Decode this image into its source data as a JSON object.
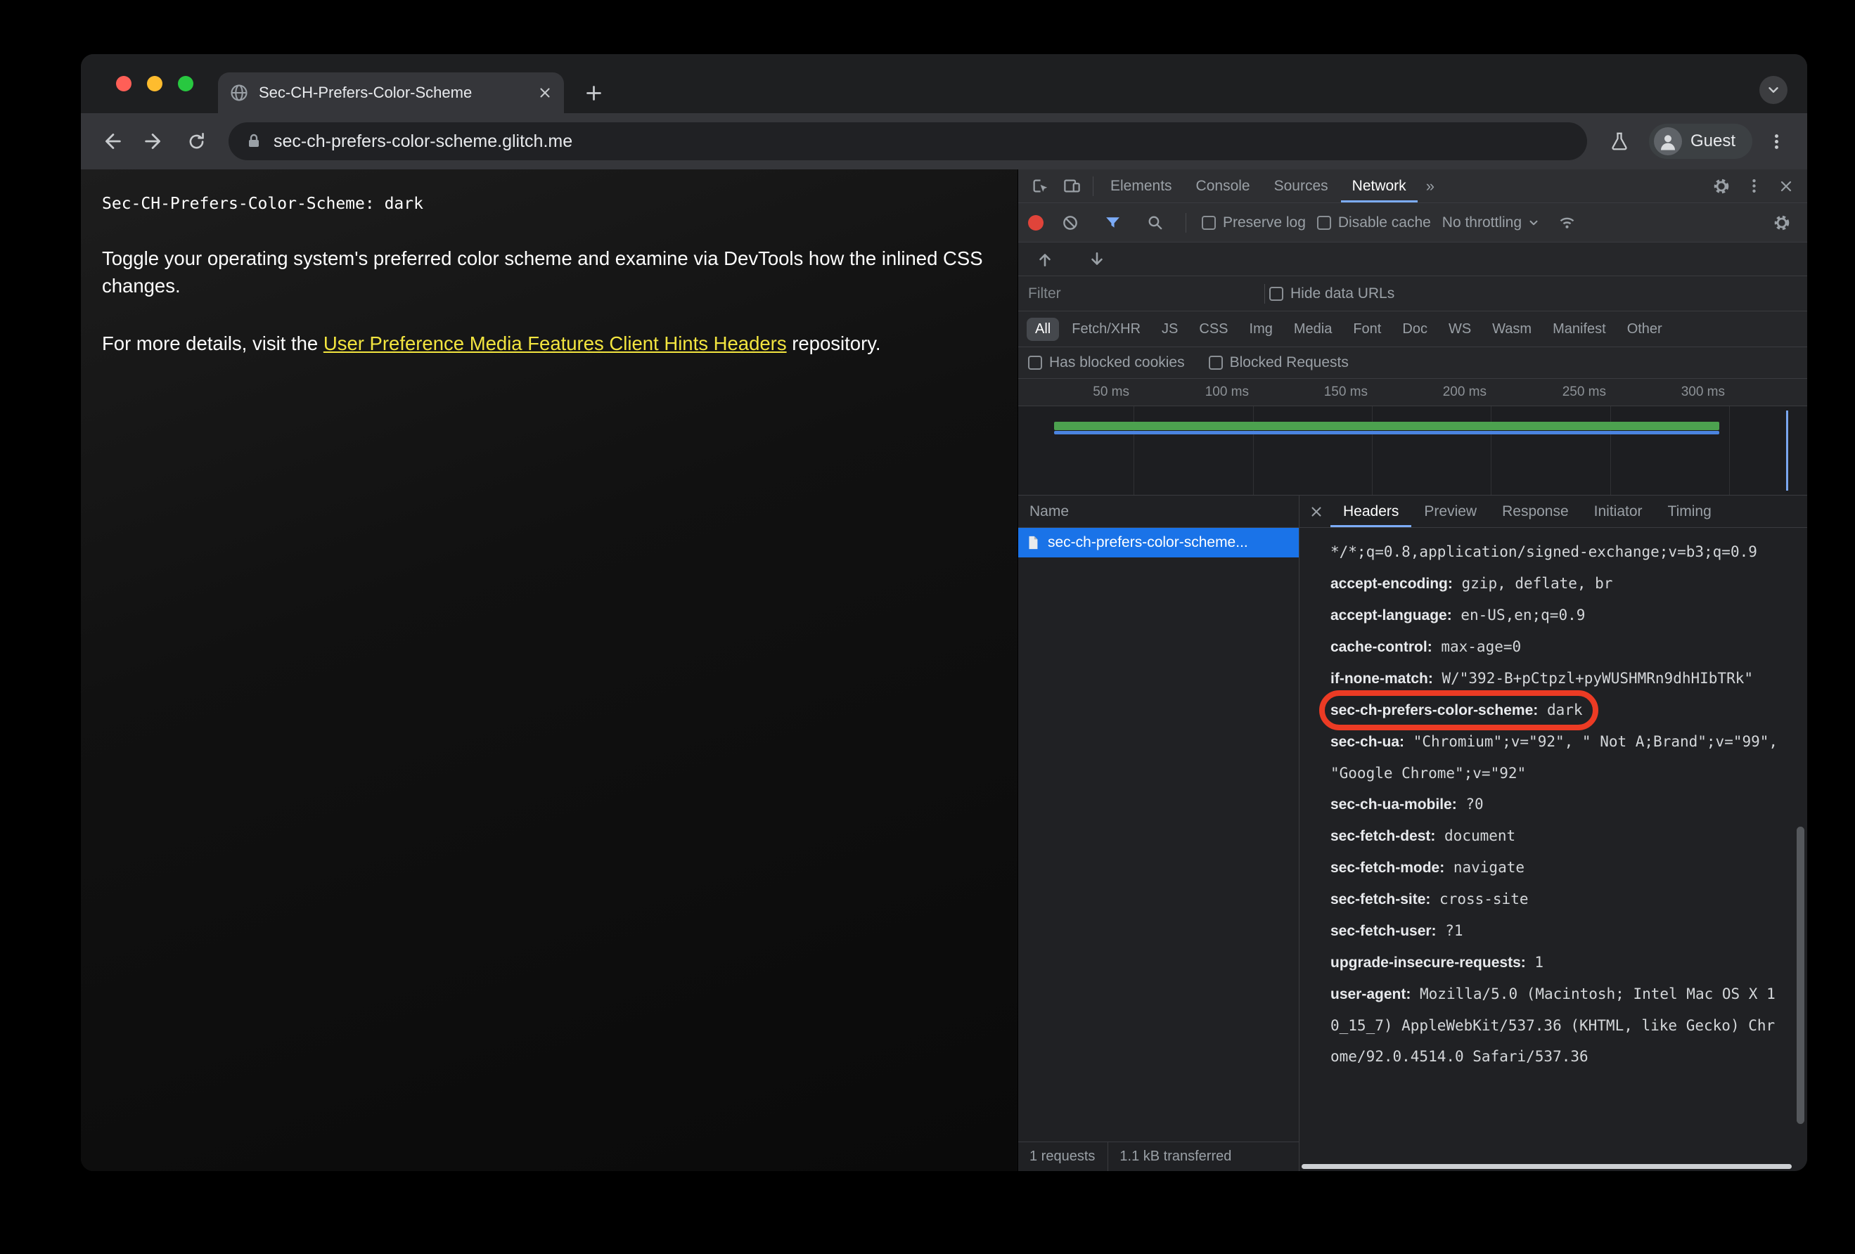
{
  "window": {
    "tab": {
      "title": "Sec-CH-Prefers-Color-Scheme"
    },
    "toolbar": {
      "url": "sec-ch-prefers-color-scheme.glitch.me",
      "profile_label": "Guest"
    }
  },
  "page": {
    "mono_line": "Sec-CH-Prefers-Color-Scheme: dark",
    "para1": "Toggle your operating system's preferred color scheme and examine via DevTools how the inlined CSS changes.",
    "para2_prefix": "For more details, visit the ",
    "para2_link": "User Preference Media Features Client Hints Headers",
    "para2_suffix": " repository."
  },
  "devtools": {
    "tabs": [
      "Elements",
      "Console",
      "Sources",
      "Network"
    ],
    "active_tab": "Network",
    "more_tabs_glyph": "»",
    "network_toolbar": {
      "preserve_log": "Preserve log",
      "disable_cache": "Disable cache",
      "throttling": "No throttling"
    },
    "filter": {
      "placeholder": "Filter",
      "hide_data_urls": "Hide data URLs"
    },
    "type_pills": [
      "All",
      "Fetch/XHR",
      "JS",
      "CSS",
      "Img",
      "Media",
      "Font",
      "Doc",
      "WS",
      "Wasm",
      "Manifest",
      "Other"
    ],
    "selected_pill": "All",
    "blocked_filters": [
      "Has blocked cookies",
      "Blocked Requests"
    ],
    "timeline_labels": [
      "50 ms",
      "100 ms",
      "150 ms",
      "200 ms",
      "250 ms",
      "300 ms"
    ],
    "request_list": {
      "header": "Name",
      "rows": [
        {
          "name": "sec-ch-prefers-color-scheme...",
          "selected": true
        }
      ]
    },
    "detail_tabs": [
      "Headers",
      "Preview",
      "Response",
      "Initiator",
      "Timing"
    ],
    "active_detail_tab": "Headers",
    "headers": [
      {
        "name": "",
        "value": "*/*;q=0.8,application/signed-exchange;v=b3;q=0.9"
      },
      {
        "name": "accept-encoding:",
        "value": "gzip, deflate, br"
      },
      {
        "name": "accept-language:",
        "value": "en-US,en;q=0.9"
      },
      {
        "name": "cache-control:",
        "value": "max-age=0"
      },
      {
        "name": "if-none-match:",
        "value": "W/\"392-B+pCtpzl+pyWUSHMRn9dhHIbTRk\""
      },
      {
        "name": "sec-ch-prefers-color-scheme:",
        "value": "dark",
        "highlighted": true
      },
      {
        "name": "sec-ch-ua:",
        "value": "\"Chromium\";v=\"92\", \" Not A;Brand\";v=\"99\", \"Google Chrome\";v=\"92\""
      },
      {
        "name": "sec-ch-ua-mobile:",
        "value": "?0"
      },
      {
        "name": "sec-fetch-dest:",
        "value": "document"
      },
      {
        "name": "sec-fetch-mode:",
        "value": "navigate"
      },
      {
        "name": "sec-fetch-site:",
        "value": "cross-site"
      },
      {
        "name": "sec-fetch-user:",
        "value": "?1"
      },
      {
        "name": "upgrade-insecure-requests:",
        "value": "1"
      },
      {
        "name": "user-agent:",
        "value": "Mozilla/5.0 (Macintosh; Intel Mac OS X 10_15_7) AppleWebKit/537.36 (KHTML, like Gecko) Chrome/92.0.4514.0 Safari/537.36"
      }
    ],
    "status": {
      "requests": "1 requests",
      "transferred": "1.1 kB transferred"
    }
  },
  "colors": {
    "accent_blue": "#7cacf8",
    "selected_row_blue": "#1a73e8",
    "annotation_red": "#ec3b24",
    "link_yellow": "#f3e53f",
    "record_red": "#e0443a",
    "timeline_green": "#4ca14f",
    "timeline_blue": "#4b84e0"
  }
}
